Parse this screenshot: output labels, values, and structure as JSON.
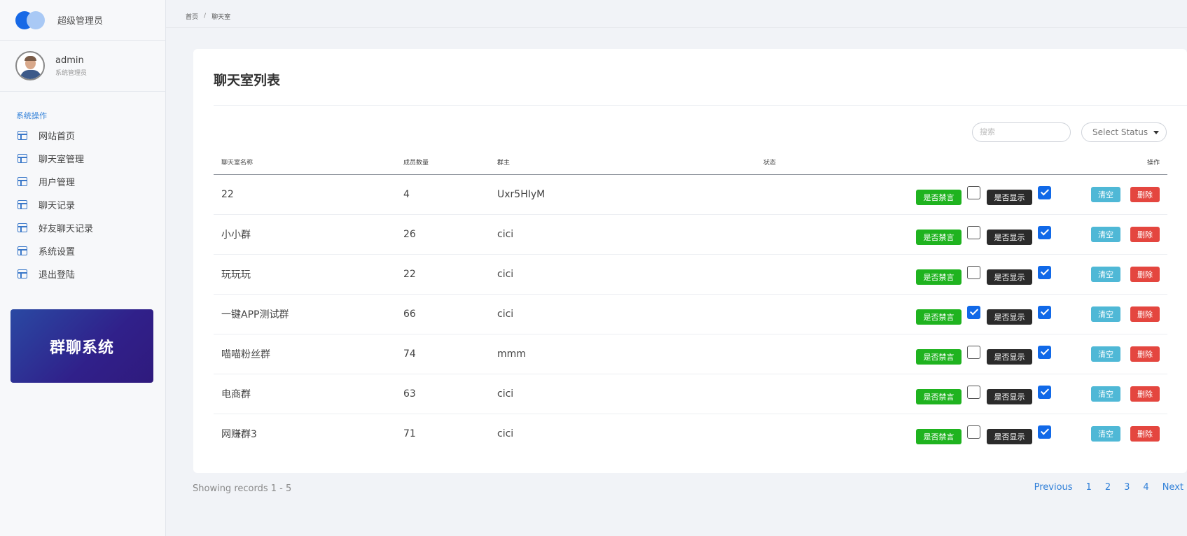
{
  "brand": {
    "title": "超级管理员"
  },
  "user": {
    "name": "admin",
    "role": "系统管理员"
  },
  "nav": {
    "section_label": "系统操作",
    "items": [
      {
        "label": "网站首页",
        "icon": "layout-icon"
      },
      {
        "label": "聊天室管理",
        "icon": "layout-icon"
      },
      {
        "label": "用户管理",
        "icon": "layout-icon"
      },
      {
        "label": "聊天记录",
        "icon": "layout-icon"
      },
      {
        "label": "好友聊天记录",
        "icon": "layout-icon"
      },
      {
        "label": "系统设置",
        "icon": "layout-icon"
      },
      {
        "label": "退出登陆",
        "icon": "layout-icon"
      }
    ]
  },
  "promo": {
    "text": "群聊系统"
  },
  "breadcrumb": {
    "home": "首页",
    "separator": "/",
    "current": "聊天室"
  },
  "card": {
    "title": "聊天室列表",
    "search_placeholder": "搜索",
    "status_select": "Select Status"
  },
  "table": {
    "headers": {
      "name": "聊天室名称",
      "members": "成员数量",
      "owner": "群主",
      "status": "状态",
      "actions": "操作"
    },
    "mute_label": "是否禁言",
    "show_label": "是否显示",
    "clear_label": "清空",
    "delete_label": "删除",
    "rows": [
      {
        "name": "22",
        "members": "4",
        "owner": "Uxr5HIyM",
        "muted": false,
        "shown": true
      },
      {
        "name": "小小群",
        "members": "26",
        "owner": "cici",
        "muted": false,
        "shown": true
      },
      {
        "name": "玩玩玩",
        "members": "22",
        "owner": "cici",
        "muted": false,
        "shown": true
      },
      {
        "name": "一键APP测试群",
        "members": "66",
        "owner": "cici",
        "muted": true,
        "shown": true
      },
      {
        "name": "喵喵粉丝群",
        "members": "74",
        "owner": "mmm",
        "muted": false,
        "shown": true
      },
      {
        "name": "电商群",
        "members": "63",
        "owner": "cici",
        "muted": false,
        "shown": true
      },
      {
        "name": "网赚群3",
        "members": "71",
        "owner": "cici",
        "muted": false,
        "shown": true
      }
    ]
  },
  "footer": {
    "records_info": "Showing records 1 - 5",
    "pager": [
      "Previous",
      "1",
      "2",
      "3",
      "4",
      "Next"
    ]
  },
  "colors": {
    "accent": "#1769e6",
    "mute_button": "#1fb31f",
    "show_button": "#2b2b2b",
    "clear_button": "#4fb8d6",
    "delete_button": "#e4463f"
  }
}
